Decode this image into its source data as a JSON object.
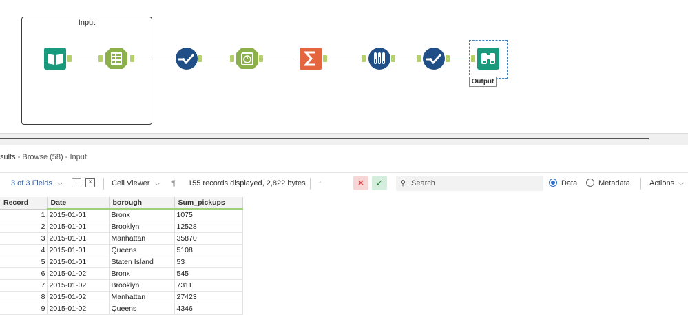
{
  "canvas": {
    "container_title": "Input",
    "output_label": "Output",
    "tools": [
      {
        "name": "input-data-tool",
        "icon": "book-icon",
        "color": "#1a9a7c"
      },
      {
        "name": "select-tool",
        "icon": "select-columns-icon",
        "color": "#8cb14a"
      },
      {
        "name": "data-cleansing-tool",
        "icon": "check-line-icon",
        "color": "#1f4f86"
      },
      {
        "name": "datetime-tool",
        "icon": "clock-icon",
        "color": "#8cb14a"
      },
      {
        "name": "summarize-tool",
        "icon": "sigma-icon",
        "color": "#e3663f"
      },
      {
        "name": "test-tool",
        "icon": "test-tubes-icon",
        "color": "#1f4f86"
      },
      {
        "name": "data-cleansing-tool-2",
        "icon": "check-line-icon",
        "color": "#1f4f86"
      },
      {
        "name": "browse-tool",
        "icon": "binoculars-icon",
        "color": "#1a9a7c"
      }
    ]
  },
  "results": {
    "title_prefix": "sults",
    "title_rest": " - Browse (58) - Input",
    "fields_label": "3 of 3 Fields",
    "cell_viewer_label": "Cell Viewer",
    "records_info": "155 records displayed, 2,822 bytes",
    "search_placeholder": "Search",
    "data_label": "Data",
    "metadata_label": "Metadata",
    "actions_label": "Actions"
  },
  "table": {
    "columns": [
      "Record",
      "Date",
      "borough",
      "Sum_pickups"
    ],
    "rows": [
      [
        "1",
        "2015-01-01",
        "Bronx",
        "1075"
      ],
      [
        "2",
        "2015-01-01",
        "Brooklyn",
        "12528"
      ],
      [
        "3",
        "2015-01-01",
        "Manhattan",
        "35870"
      ],
      [
        "4",
        "2015-01-01",
        "Queens",
        "5108"
      ],
      [
        "5",
        "2015-01-01",
        "Staten Island",
        "53"
      ],
      [
        "6",
        "2015-01-02",
        "Bronx",
        "545"
      ],
      [
        "7",
        "2015-01-02",
        "Brooklyn",
        "7311"
      ],
      [
        "8",
        "2015-01-02",
        "Manhattan",
        "27423"
      ],
      [
        "9",
        "2015-01-02",
        "Queens",
        "4346"
      ]
    ]
  },
  "colors": {
    "accent": "#2f6fbf",
    "anchor_green": "#b5cf6b",
    "header_underline": "#9fd17c"
  }
}
